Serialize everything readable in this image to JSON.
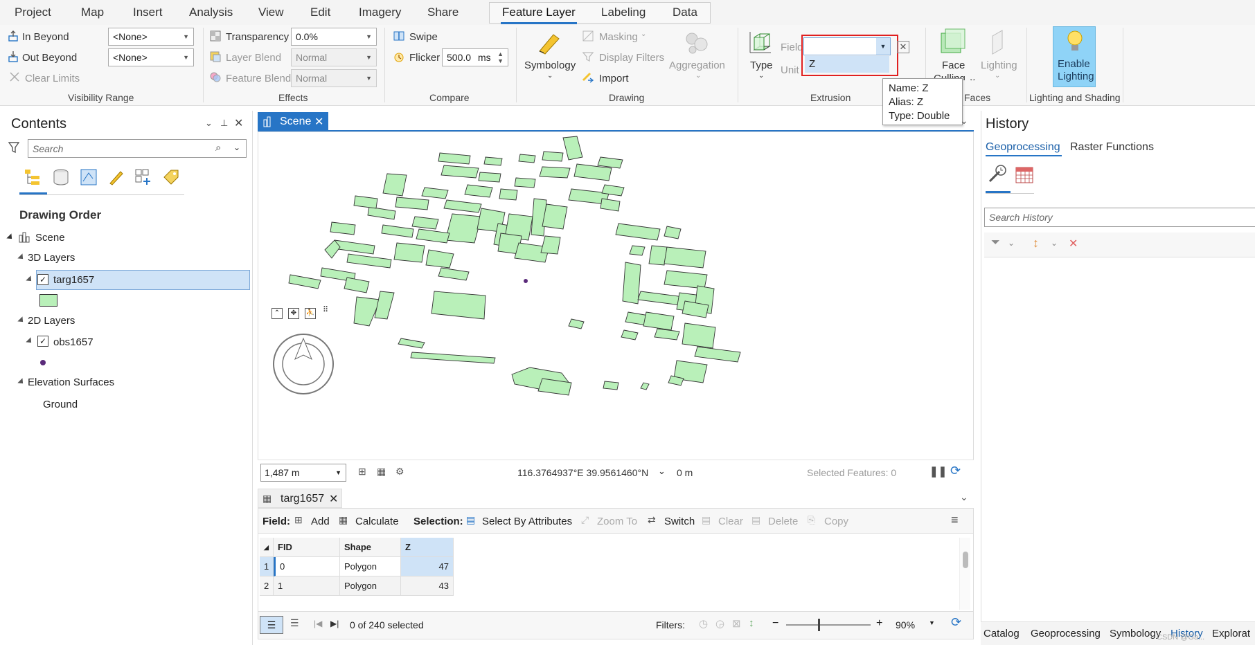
{
  "menu": {
    "items": [
      "Project",
      "Map",
      "Insert",
      "Analysis",
      "View",
      "Edit",
      "Imagery",
      "Share"
    ],
    "context_tabs": [
      "Feature Layer",
      "Labeling",
      "Data"
    ],
    "active_tab": "Feature Layer"
  },
  "ribbon": {
    "visibility": {
      "in_beyond_label": "In Beyond",
      "in_beyond_value": "<None>",
      "out_beyond_label": "Out Beyond",
      "out_beyond_value": "<None>",
      "clear_limits": "Clear Limits",
      "group_label": "Visibility Range"
    },
    "effects": {
      "transparency_label": "Transparency",
      "transparency_value": "0.0%",
      "layer_blend_label": "Layer Blend",
      "layer_blend_value": "Normal",
      "feature_blend_label": "Feature Blend",
      "feature_blend_value": "Normal",
      "group_label": "Effects"
    },
    "compare": {
      "swipe": "Swipe",
      "flicker_label": "Flicker",
      "flicker_value": "500.0",
      "flicker_unit": "ms",
      "group_label": "Compare"
    },
    "drawing": {
      "symbology": "Symbology",
      "masking": "Masking",
      "display_filters": "Display Filters",
      "import": "Import",
      "aggregation": "Aggregation",
      "group_label": "Drawing"
    },
    "extrusion": {
      "type_label": "Type",
      "field_label": "Field",
      "unit_label": "Unit",
      "field_option": "Z",
      "group_label": "Extrusion"
    },
    "faces": {
      "face_culling": "Face Culling",
      "lighting": "Lighting",
      "group_label": "Faces"
    },
    "lighting_shading": {
      "enable_lighting_line1": "Enable",
      "enable_lighting_line2": "Lighting",
      "group_label": "Lighting and Shading"
    }
  },
  "tooltip": {
    "name": "Name: Z",
    "alias": "Alias: Z",
    "type": "Type: Double"
  },
  "contents": {
    "title": "Contents",
    "search_placeholder": "Search",
    "drawing_order": "Drawing Order",
    "scene": "Scene",
    "layers_3d": "3D Layers",
    "layer_3d_name": "targ1657",
    "layers_2d": "2D Layers",
    "layer_2d_name": "obs1657",
    "elevation_surfaces": "Elevation Surfaces",
    "ground": "Ground"
  },
  "scene": {
    "tab_label": "Scene",
    "scale": "1,487 m",
    "coordinates": "116.3764937°E 39.9561460°N",
    "elevation": "0 m",
    "selected_features": "Selected Features: 0"
  },
  "table": {
    "tab_label": "targ1657",
    "field_label": "Field:",
    "add": "Add",
    "calculate": "Calculate",
    "selection_label": "Selection:",
    "select_by_attributes": "Select By Attributes",
    "zoom_to": "Zoom To",
    "switch": "Switch",
    "clear": "Clear",
    "delete": "Delete",
    "copy": "Copy",
    "columns": [
      "FID",
      "Shape",
      "Z"
    ],
    "rows": [
      {
        "row": "1",
        "fid": "0",
        "shape": "Polygon",
        "z": "47"
      },
      {
        "row": "2",
        "fid": "1",
        "shape": "Polygon",
        "z": "43"
      }
    ],
    "selected_count": "0 of 240 selected",
    "filters_label": "Filters:",
    "zoom": "90%"
  },
  "history": {
    "title": "History",
    "tab_geoprocessing": "Geoprocessing",
    "tab_raster": "Raster Functions",
    "search_placeholder": "Search History"
  },
  "dock": {
    "tabs": [
      "Catalog",
      "Geoprocessing",
      "Symbology",
      "History",
      "Explorat"
    ]
  },
  "watermark": "CSDN @Ga...",
  "colors": {
    "accent": "#2775c6",
    "building_fill": "#b9f0b9",
    "highlight": "#cfe3f7",
    "red_outline": "#e02020",
    "lighting_button": "#8fd3f7"
  }
}
